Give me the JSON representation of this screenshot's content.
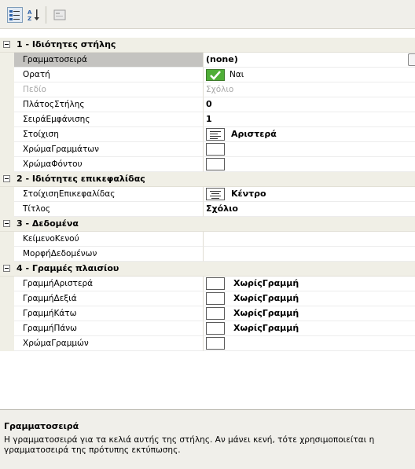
{
  "toolbar": {
    "categorized_icon": "categorized-icon",
    "alphabetical_icon": "sort-alphabetical-icon",
    "property_pages_icon": "property-pages-icon"
  },
  "categories": [
    {
      "label": "1 - Ιδιότητες στήλης",
      "props": [
        {
          "name": "Γραμματοσειρά",
          "value": "(none)",
          "kind": "bold-text",
          "selected": true,
          "ellipsis": true
        },
        {
          "name": "Ορατή",
          "value": "Ναι",
          "kind": "check"
        },
        {
          "name": "Πεδίο",
          "value": "Σχόλιο",
          "kind": "grey",
          "disabled": true
        },
        {
          "name": "ΠλάτοςΣτήλης",
          "value": "0",
          "kind": "bold-text"
        },
        {
          "name": "ΣειράΕμφάνισης",
          "value": "1",
          "kind": "bold-text"
        },
        {
          "name": "Στοίχιση",
          "value": "Αριστερά",
          "kind": "align"
        },
        {
          "name": "ΧρώμαΓραμμάτων",
          "value": "",
          "kind": "swatch"
        },
        {
          "name": "ΧρώμαΦόντου",
          "value": "",
          "kind": "swatch"
        }
      ]
    },
    {
      "label": "2 - Ιδιότητες επικεφαλίδας",
      "props": [
        {
          "name": "ΣτοίχισηΕπικεφαλίδας",
          "value": "Κέντρο",
          "kind": "align"
        },
        {
          "name": "Τίτλος",
          "value": "Σχόλιο",
          "kind": "bold-text"
        }
      ]
    },
    {
      "label": "3 - Δεδομένα",
      "props": [
        {
          "name": "ΚείμενοΚενού",
          "value": "",
          "kind": "text"
        },
        {
          "name": "ΜορφήΔεδομένων",
          "value": "",
          "kind": "text"
        }
      ]
    },
    {
      "label": "4 - Γραμμές πλαισίου",
      "props": [
        {
          "name": "ΓραμμήΑριστερά",
          "value": "ΧωρίςΓραμμή",
          "kind": "swatch"
        },
        {
          "name": "ΓραμμήΔεξιά",
          "value": "ΧωρίςΓραμμή",
          "kind": "swatch"
        },
        {
          "name": "ΓραμμήΚάτω",
          "value": "ΧωρίςΓραμμή",
          "kind": "swatch"
        },
        {
          "name": "ΓραμμήΠάνω",
          "value": "ΧωρίςΓραμμή",
          "kind": "swatch"
        },
        {
          "name": "ΧρώμαΓραμμών",
          "value": "",
          "kind": "swatch"
        }
      ]
    }
  ],
  "description": {
    "title": "Γραμματοσειρά",
    "text": "Η γραμματοσειρά για τα κελιά αυτής της στήλης. Αν μάνει κενή, τότε χρησιμοποιείται η γραμματοσειρά της πρότυπης εκτύπωσης."
  },
  "colors": {
    "toolbar_bg": "#f0efea",
    "gutter_bg": "#f0efe6",
    "selected_bg": "#c4c3c0",
    "check_green": "#4fae37"
  }
}
